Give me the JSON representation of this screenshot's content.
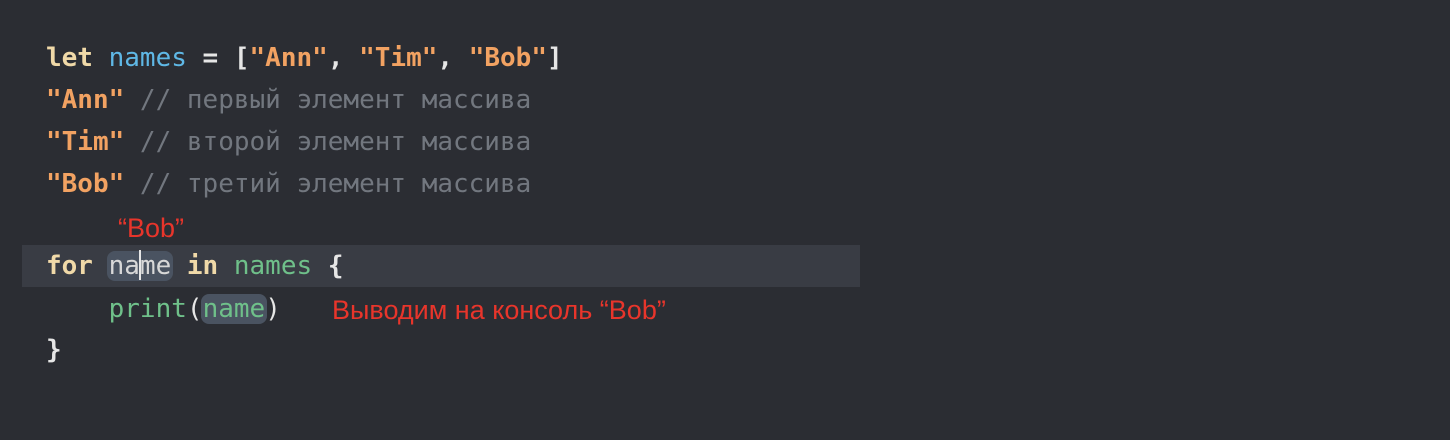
{
  "code": {
    "line1": {
      "keyword": "let",
      "name": "names",
      "eq": " = [",
      "s1": "\"Ann\"",
      "sep1": ", ",
      "s2": "\"Tim\"",
      "sep2": ", ",
      "s3": "\"Bob\"",
      "close": "]"
    },
    "line2": {
      "str": "\"Ann\"",
      "comment": " // первый элемент массива"
    },
    "line3": {
      "str": "\"Tim\"",
      "comment": " // второй элемент массива"
    },
    "line4": {
      "str": "\"Bob\"",
      "comment": " // третий элемент массива"
    },
    "line5": {
      "kw_for": "for",
      "var_a": "na",
      "var_b": "me",
      "kw_in": "in",
      "coll": "names",
      "brace": "{"
    },
    "line6": {
      "indent": "    ",
      "fn": "print",
      "open": "(",
      "arg": "name",
      "close": ")"
    },
    "line7": {
      "brace": "}"
    }
  },
  "annotations": {
    "bob_value": "“Bob”",
    "console_output": "Выводим на консоль “Bob”"
  },
  "colors": {
    "background": "#2b2d33",
    "keyword": "#f0d9a8",
    "identifier": "#5fb8e6",
    "string": "#f2a262",
    "comment": "#72777f",
    "function": "#6fc08a",
    "annotation": "#e8352b"
  }
}
